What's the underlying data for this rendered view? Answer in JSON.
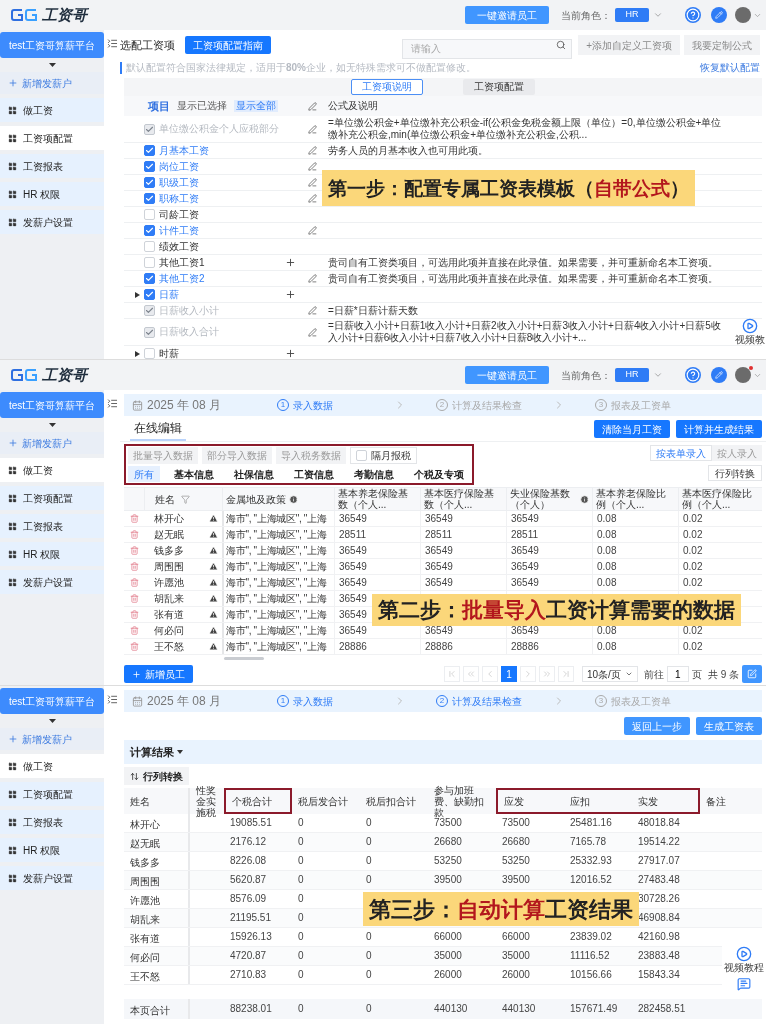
{
  "config_screen": {
    "top_bar": {
      "logo": "工资哥",
      "invite_button": "一键邀请员工",
      "role_label": "当前角色：",
      "role": "HR",
      "notification": false
    },
    "sidebar": {
      "platform": "test工资哥算薪平台",
      "add_item": "新增发薪户",
      "items": [
        {
          "label": "做工资",
          "selected": false
        },
        {
          "label": "工资项配置",
          "selected": true
        },
        {
          "label": "工资报表",
          "selected": false
        },
        {
          "label": "HR 权限",
          "selected": false
        },
        {
          "label": "发薪户设置",
          "selected": false
        }
      ]
    },
    "title": "选配工资项",
    "guide_button": "工资项配置指南",
    "search": {
      "placeholder": "请输入"
    },
    "add_button": "+添加自定义工资项",
    "formula_button": "我要定制公式",
    "notice": "默认配置符合国家法律规定，适用于**80%**企业，如无特殊需求可不做配置修改。",
    "restore_link": "恢复默认配置",
    "tabs": [
      {
        "label": "工资项说明",
        "selected": true
      },
      {
        "label": "工资项配置",
        "selected": false
      }
    ],
    "item_header": "项目",
    "view_options": [
      {
        "label": "显示已选择",
        "selected": false
      },
      {
        "label": "显示全部",
        "selected": true
      }
    ],
    "formula_header": "公式及说明",
    "rows": [
      {
        "label": "单位缴公积金个人应税部分",
        "checked": true,
        "disabled": true,
        "kind": "edit",
        "formula": "=单位缴公积金+单位缴补充公积金-if(公积金免税金额上限（单位）=0,单位缴公积金+单位缴补充公积金,min(单位缴公积金+单位缴补充公积金,公积..."
      },
      {
        "label": "月基本工资",
        "checked": true,
        "disabled": false,
        "kind": "edit",
        "formula": "劳务人员的月基本收入也可用此项。"
      },
      {
        "label": "岗位工资",
        "checked": true,
        "disabled": false,
        "kind": "edit"
      },
      {
        "label": "职级工资",
        "checked": true,
        "disabled": false,
        "kind": "edit"
      },
      {
        "label": "职称工资",
        "checked": true,
        "disabled": false,
        "kind": "edit"
      },
      {
        "label": "司龄工资",
        "checked": false,
        "disabled": false,
        "kind": "plain"
      },
      {
        "label": "计件工资",
        "checked": true,
        "disabled": false,
        "kind": "edit"
      },
      {
        "label": "绩效工资",
        "checked": false,
        "disabled": false,
        "kind": "plain"
      },
      {
        "label": "其他工资1",
        "checked": false,
        "disabled": false,
        "kind": "add",
        "formula": "贵司自有工资类项目，可选用此项并直接在此录值。如果需要，并可重新命名本工资项。"
      },
      {
        "label": "其他工资2",
        "checked": true,
        "disabled": false,
        "kind": "edit",
        "formula": "贵司自有工资类项目，可选用此项并直接在此录值。如果需要，并可重新命名本工资项。"
      },
      {
        "label": "日薪",
        "checked": true,
        "disabled": false,
        "expanded": false,
        "kind": "add"
      },
      {
        "label": "日薪收入小计",
        "checked": true,
        "disabled": true,
        "kind": "edit",
        "formula": "=日薪*日薪计薪天数"
      },
      {
        "label": "日薪收入合计",
        "checked": true,
        "disabled": true,
        "kind": "edit",
        "formula": "=日薪收入小计+日薪1收入小计+日薪2收入小计+日薪3收入小计+日薪4收入小计+日薪5收入小计+日薪6收入小计+日薪7收入小计+日薪8收入小计+..."
      },
      {
        "label": "时薪",
        "checked": false,
        "disabled": false,
        "expanded": false,
        "kind": "add"
      }
    ],
    "caption": [
      {
        "text": "第一步：配置专属工资表模板（",
        "emphasis": false
      },
      {
        "text": "自带公式",
        "emphasis": true
      },
      {
        "text": "）",
        "emphasis": false
      }
    ],
    "video_button": "视频教"
  },
  "import_screen": {
    "top_bar": {
      "logo": "工资哥",
      "invite_button": "一键邀请员工",
      "role_label": "当前角色：",
      "role": "HR",
      "notification": true
    },
    "sidebar": {
      "platform": "test工资哥算薪平台",
      "add_item": "新增发薪户",
      "items": [
        {
          "label": "做工资",
          "selected": true
        },
        {
          "label": "工资项配置",
          "selected": false
        },
        {
          "label": "工资报表",
          "selected": false
        },
        {
          "label": "HR 权限",
          "selected": false
        },
        {
          "label": "发薪户设置",
          "selected": false
        }
      ]
    },
    "period": "2025 年 08 月",
    "steps": [
      {
        "number": "1",
        "label": "录入数据",
        "active": true
      },
      {
        "number": "2",
        "label": "计算及结果检查",
        "active": false
      },
      {
        "number": "3",
        "label": "报表及工资单",
        "active": false
      }
    ],
    "heading": "在线编辑",
    "clear_button": "清除当月工资",
    "calculate_button": "计算并生成结果",
    "import_buttons": [
      "批量导入数据",
      "部分导入数据",
      "导入税务数据"
    ],
    "separate_month": {
      "label": "隔月报税",
      "checked": false
    },
    "tabs": [
      {
        "label": "所有",
        "selected": true
      },
      {
        "label": "基本信息",
        "selected": false
      },
      {
        "label": "社保信息",
        "selected": false
      },
      {
        "label": "工资信息",
        "selected": false
      },
      {
        "label": "考勤信息",
        "selected": false
      },
      {
        "label": "个税及专项",
        "selected": false
      }
    ],
    "entry_modes": [
      {
        "label": "按表单录入",
        "selected": true
      },
      {
        "label": "按人录入",
        "selected": false
      }
    ],
    "transpose_button": "行列转换",
    "columns": [
      {
        "label": "姓名",
        "kind": "filter"
      },
      {
        "label": "金属地及政策",
        "kind": "info"
      },
      {
        "label": "基本养老保险基数（个人...",
        "kind": "plain"
      },
      {
        "label": "基本医疗保险基数（个人...",
        "kind": "plain"
      },
      {
        "label": "失业保险基数（个人）",
        "kind": "info"
      },
      {
        "label": "基本养老保险比例（个人...",
        "kind": "plain"
      },
      {
        "label": "基本医疗保险比例（个人...",
        "kind": "plain"
      }
    ],
    "rows": [
      {
        "name": "林开心",
        "policy": "海市\", \"上海城区\", \"上海",
        "values": [
          "36549",
          "36549",
          "36549",
          "0.08",
          "0.02"
        ]
      },
      {
        "name": "赵无眠",
        "policy": "海市\", \"上海城区\", \"上海",
        "values": [
          "28511",
          "28511",
          "28511",
          "0.08",
          "0.02"
        ]
      },
      {
        "name": "钱多多",
        "policy": "海市\", \"上海城区\", \"上海",
        "values": [
          "36549",
          "36549",
          "36549",
          "0.08",
          "0.02"
        ]
      },
      {
        "name": "周围围",
        "policy": "海市\", \"上海城区\", \"上海",
        "values": [
          "36549",
          "36549",
          "36549",
          "0.08",
          "0.02"
        ]
      },
      {
        "name": "许愿池",
        "policy": "海市\", \"上海城区\", \"上海",
        "values": [
          "36549",
          "36549",
          "36549",
          "0.08",
          "0.02"
        ]
      },
      {
        "name": "胡乱来",
        "policy": "海市\", \"上海城区\", \"上海",
        "values": [
          "36549"
        ]
      },
      {
        "name": "张有道",
        "policy": "海市\", \"上海城区\", \"上海",
        "values": [
          "36549"
        ]
      },
      {
        "name": "何必问",
        "policy": "海市\", \"上海城区\", \"上海",
        "values": [
          "36549",
          "36549",
          "36549",
          "0.08",
          "0.02"
        ]
      },
      {
        "name": "王不怒",
        "policy": "海市\", \"上海城区\", \"上海",
        "values": [
          "28886",
          "28886",
          "28886",
          "0.08",
          "0.02"
        ]
      }
    ],
    "add_employee_button": "新增员工",
    "pagination": {
      "pages": [
        {
          "label": "1",
          "selected": true
        }
      ],
      "page_size": "10条/页",
      "goto_label": "前往",
      "goto_value": "1",
      "page_unit": "页",
      "total": "共 9 条"
    },
    "caption": [
      {
        "text": "第二步：",
        "emphasis": false
      },
      {
        "text": "批量导入",
        "emphasis": true
      },
      {
        "text": "工资计算需要的数据",
        "emphasis": false
      }
    ]
  },
  "result_screen": {
    "sidebar": {
      "platform": "test工资哥算薪平台",
      "add_item": "新增发薪户",
      "items": [
        {
          "label": "做工资",
          "selected": true
        },
        {
          "label": "工资项配置",
          "selected": false
        },
        {
          "label": "工资报表",
          "selected": false
        },
        {
          "label": "HR 权限",
          "selected": false
        },
        {
          "label": "发薪户设置",
          "selected": false
        }
      ]
    },
    "period": "2025 年 08 月",
    "steps": [
      {
        "number": "1",
        "label": "录入数据",
        "active": true
      },
      {
        "number": "2",
        "label": "计算及结果检查",
        "active": true
      },
      {
        "number": "3",
        "label": "报表及工资单",
        "active": false
      }
    ],
    "back_button": "返回上一步",
    "generate_button": "生成工资表",
    "result_title": "计算结果",
    "transpose_button": "行列转换",
    "columns": [
      {
        "label": "姓名",
        "highlighted": false
      },
      {
        "label": "性奖金实施税",
        "highlighted": false
      },
      {
        "label": "个税合计",
        "highlighted": true
      },
      {
        "label": "税后发合计",
        "highlighted": false
      },
      {
        "label": "税后扣合计",
        "highlighted": false
      },
      {
        "label": "参与加班费、缺勤扣款",
        "highlighted": false
      },
      {
        "label": "应发",
        "highlighted": true
      },
      {
        "label": "应扣",
        "highlighted": true
      },
      {
        "label": "实发",
        "highlighted": true
      },
      {
        "label": "备注",
        "highlighted": false
      }
    ],
    "rows": [
      {
        "name": "林开心",
        "kind": "full",
        "values": [
          "19085.51",
          "0",
          "0",
          "73500",
          "73500",
          "25481.16",
          "48018.84"
        ]
      },
      {
        "name": "赵无眠",
        "kind": "full",
        "values": [
          "2176.12",
          "0",
          "0",
          "26680",
          "26680",
          "7165.78",
          "19514.22"
        ]
      },
      {
        "name": "钱多多",
        "kind": "full",
        "values": [
          "8226.08",
          "0",
          "0",
          "53250",
          "53250",
          "25332.93",
          "27917.07"
        ]
      },
      {
        "name": "周围围",
        "kind": "full",
        "values": [
          "5620.87",
          "0",
          "0",
          "39500",
          "39500",
          "12016.52",
          "27483.48"
        ]
      },
      {
        "name": "许愿池",
        "kind": "covered",
        "values": [
          "8576.09",
          "0",
          "30728.26"
        ]
      },
      {
        "name": "胡乱来",
        "kind": "covered",
        "values": [
          "21195.51",
          "0",
          "46908.84"
        ]
      },
      {
        "name": "张有道",
        "kind": "full",
        "values": [
          "15926.13",
          "0",
          "0",
          "66000",
          "66000",
          "23839.02",
          "42160.98"
        ]
      },
      {
        "name": "何必问",
        "kind": "full",
        "values": [
          "4720.87",
          "0",
          "0",
          "35000",
          "35000",
          "11116.52",
          "23883.48"
        ]
      },
      {
        "name": "王不怒",
        "kind": "full",
        "values": [
          "2710.83",
          "0",
          "0",
          "26000",
          "26000",
          "10156.66",
          "15843.34"
        ]
      }
    ],
    "total_row": {
      "name": "本页合计",
      "kind": "full",
      "values": [
        "88238.01",
        "0",
        "0",
        "440130",
        "440130",
        "157671.49",
        "282458.51"
      ]
    },
    "caption": [
      {
        "text": "第三步：",
        "emphasis": false
      },
      {
        "text": "自动计算",
        "emphasis": true
      },
      {
        "text": "工资结果",
        "emphasis": false
      }
    ],
    "video_button": "视频教程"
  }
}
